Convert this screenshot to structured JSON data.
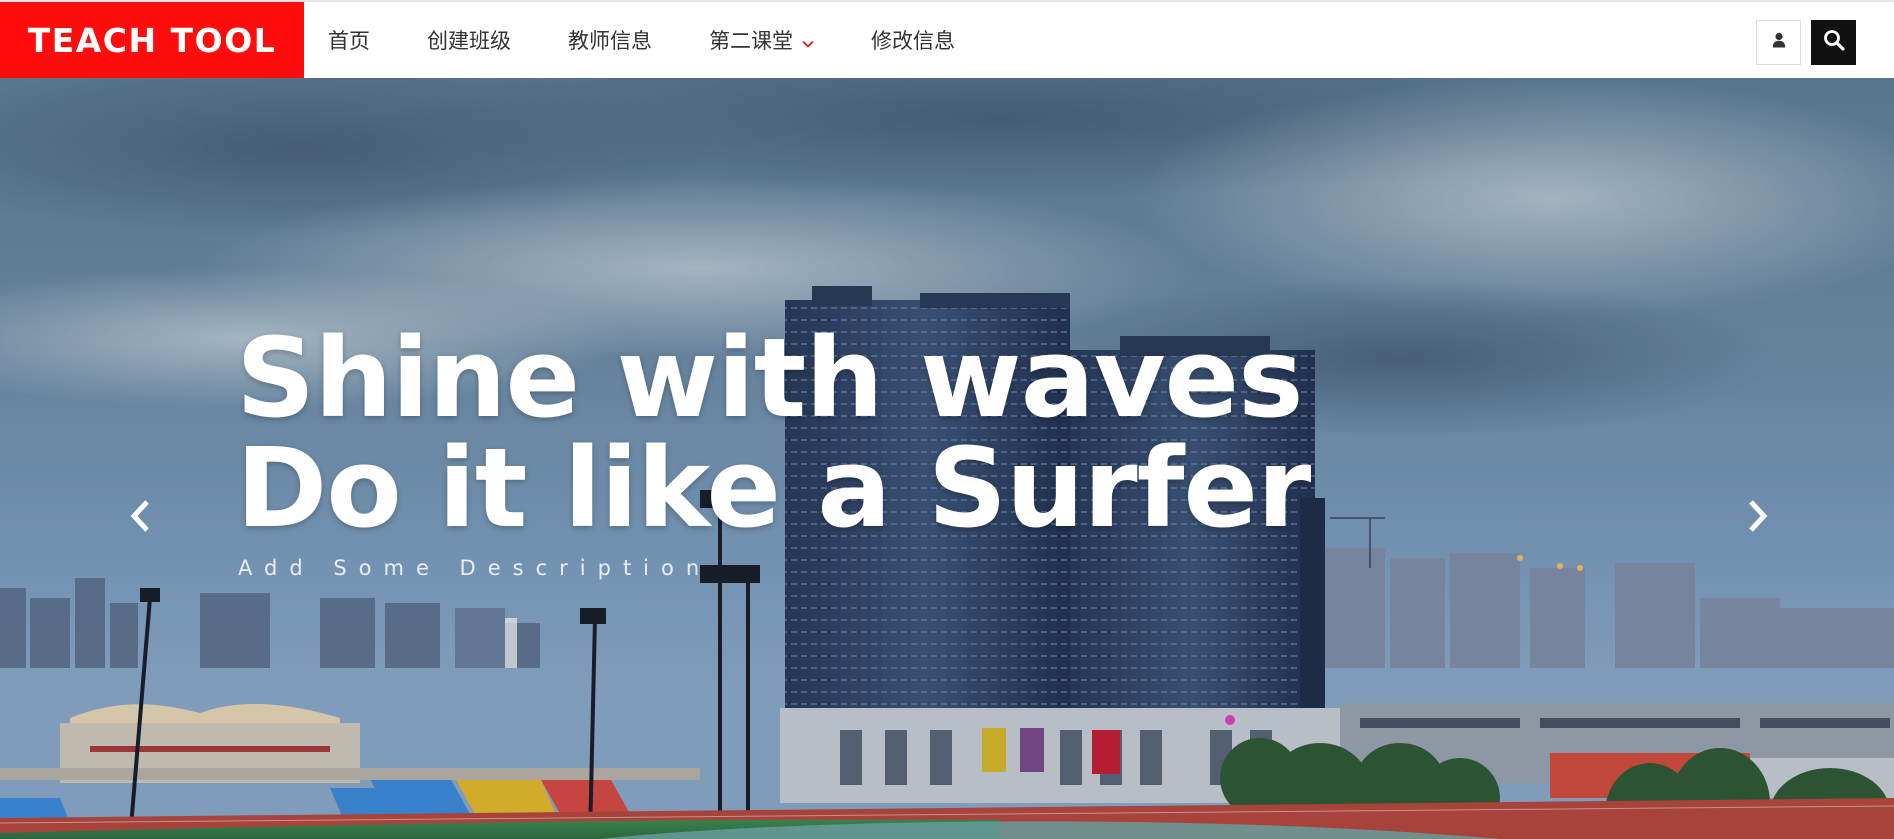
{
  "brand": {
    "name": "TEACH TOOL",
    "color": "#ff0d0d"
  },
  "nav": {
    "items": [
      {
        "label": "首页"
      },
      {
        "label": "创建班级"
      },
      {
        "label": "教师信息"
      },
      {
        "label": "第二课堂",
        "has_dropdown": true
      },
      {
        "label": "修改信息"
      }
    ],
    "dropdown_icon": "chevron-down-icon",
    "dropdown_icon_color": "#e0161b"
  },
  "header_actions": {
    "user_icon": "user-icon",
    "search_icon": "search-icon"
  },
  "hero": {
    "headline_line1": "Shine with waves",
    "headline_line2": "Do it like a Surfer",
    "description": "Add Some Description",
    "prev_icon": "chevron-left-icon",
    "next_icon": "chevron-right-icon",
    "background": "city skyline with stadium and running track at dusk"
  }
}
